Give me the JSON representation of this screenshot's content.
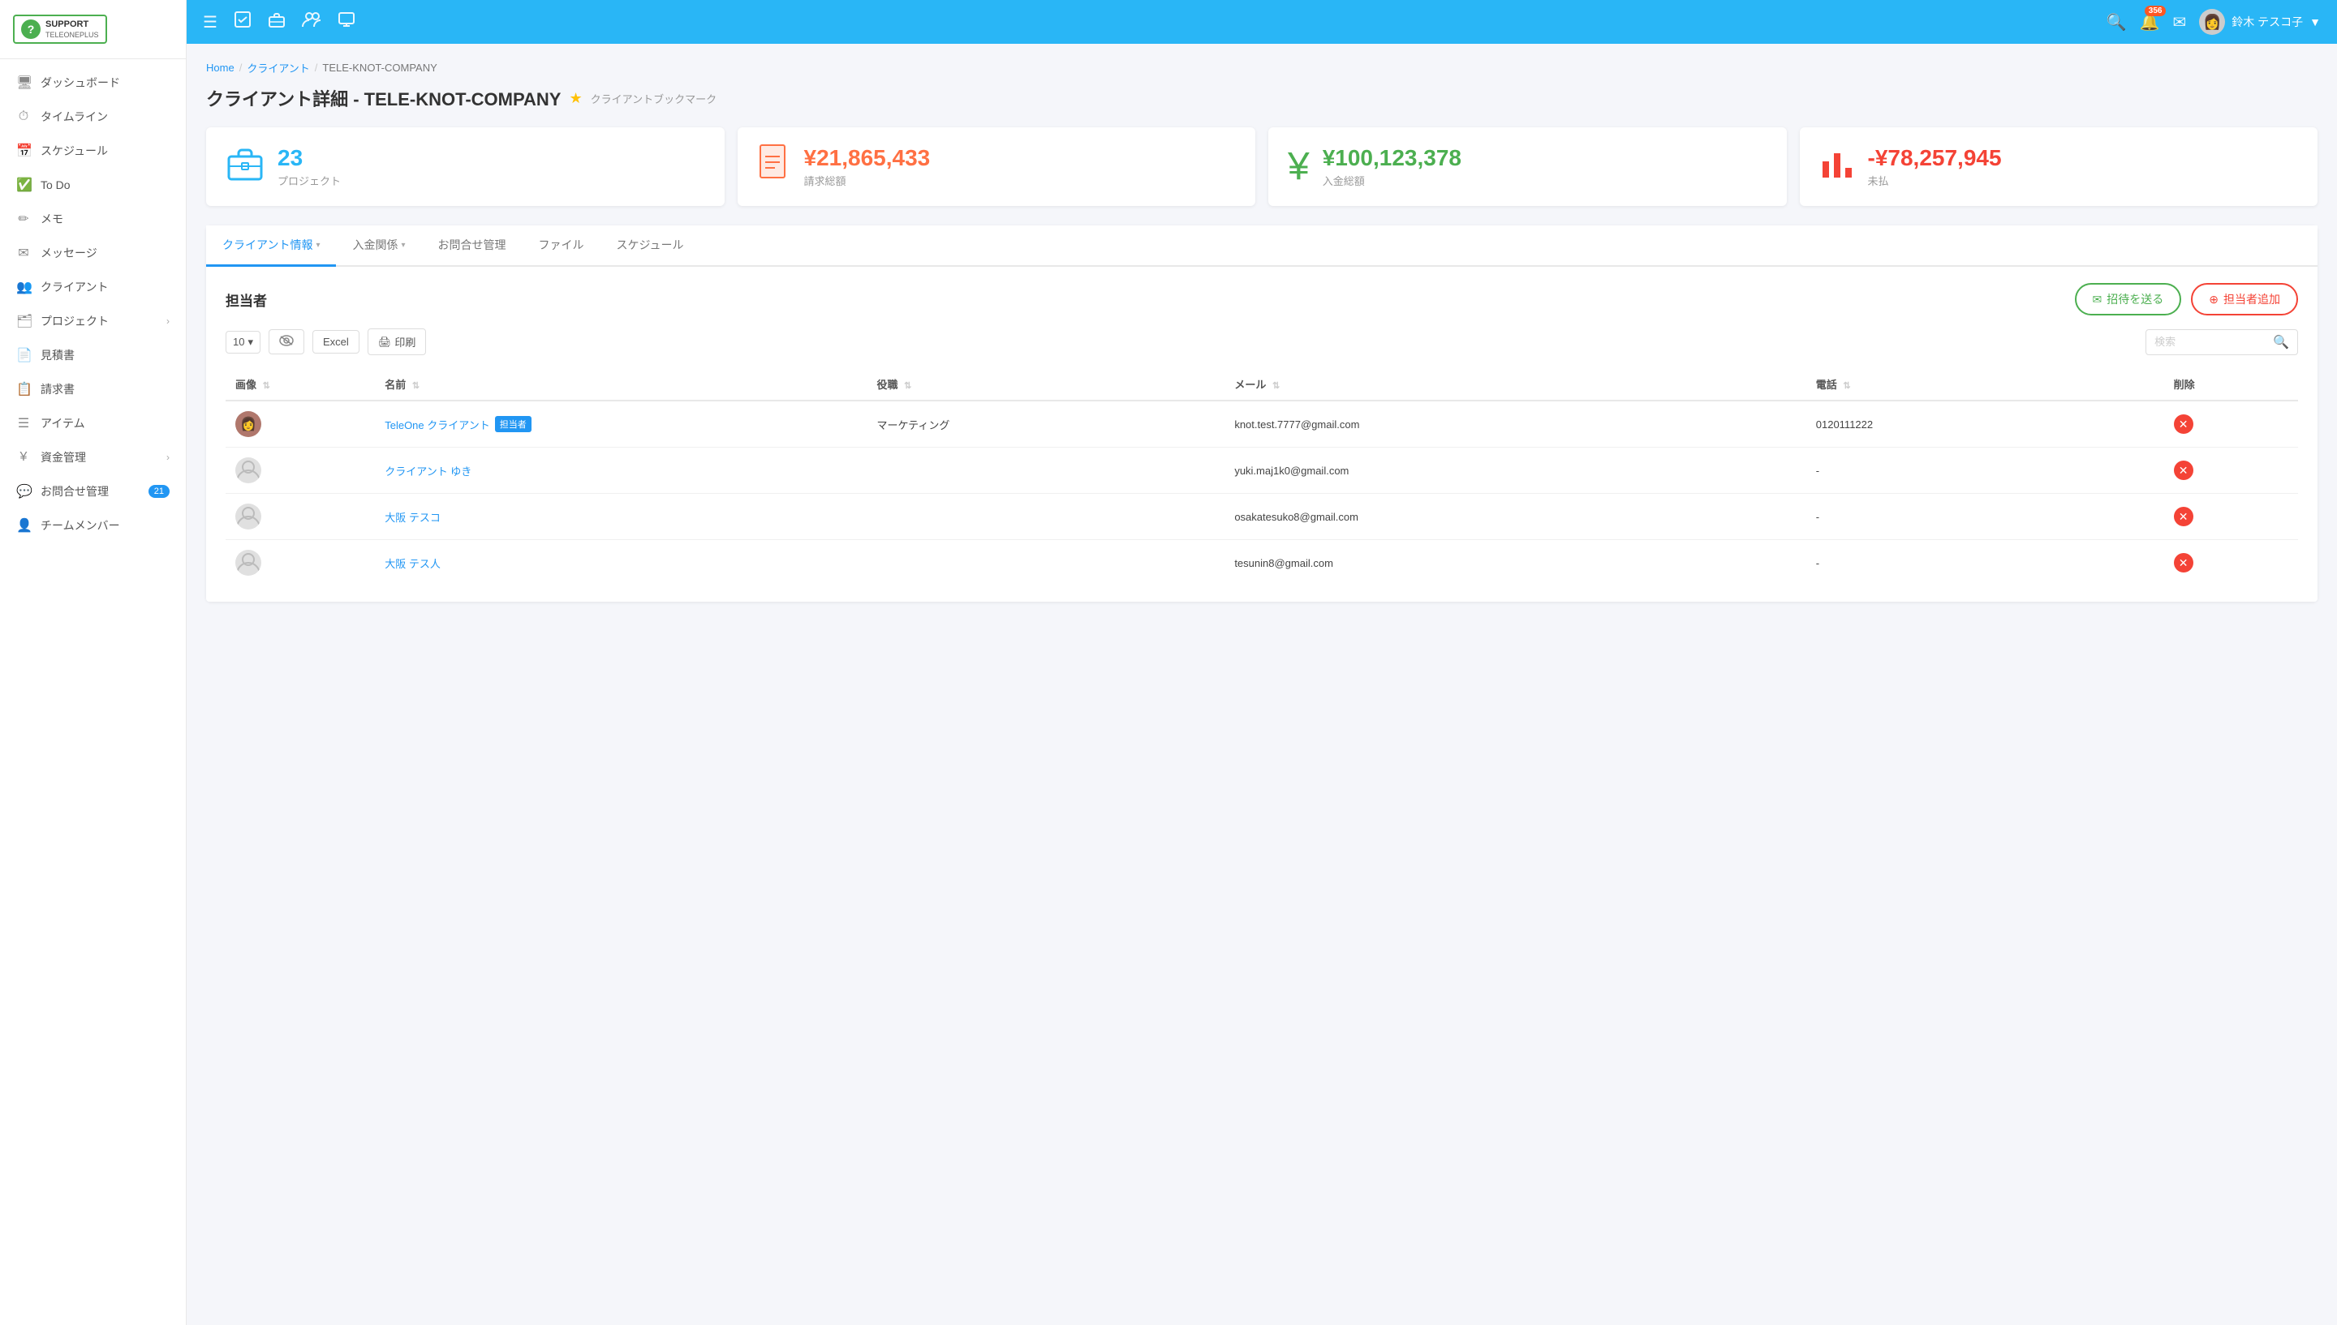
{
  "sidebar": {
    "logo": {
      "icon": "?",
      "text": "SUPPORT",
      "sub": "TELEONEPLUS"
    },
    "items": [
      {
        "id": "dashboard",
        "label": "ダッシュボード",
        "icon": "🖥",
        "badge": null,
        "arrow": false
      },
      {
        "id": "timeline",
        "label": "タイムライン",
        "icon": "⏱",
        "badge": null,
        "arrow": false
      },
      {
        "id": "schedule",
        "label": "スケジュール",
        "icon": "📅",
        "badge": null,
        "arrow": false
      },
      {
        "id": "todo",
        "label": "To Do",
        "icon": "✅",
        "badge": null,
        "arrow": false
      },
      {
        "id": "memo",
        "label": "メモ",
        "icon": "✏",
        "badge": null,
        "arrow": false
      },
      {
        "id": "message",
        "label": "メッセージ",
        "icon": "✉",
        "badge": null,
        "arrow": false
      },
      {
        "id": "client",
        "label": "クライアント",
        "icon": "👥",
        "badge": null,
        "arrow": false
      },
      {
        "id": "project",
        "label": "プロジェクト",
        "icon": "🗂",
        "badge": null,
        "arrow": true
      },
      {
        "id": "estimate",
        "label": "見積書",
        "icon": "📄",
        "badge": null,
        "arrow": false
      },
      {
        "id": "invoice",
        "label": "請求書",
        "icon": "📋",
        "badge": null,
        "arrow": false
      },
      {
        "id": "item",
        "label": "アイテム",
        "icon": "☰",
        "badge": null,
        "arrow": false
      },
      {
        "id": "finance",
        "label": "資金管理",
        "icon": "¥",
        "badge": null,
        "arrow": true
      },
      {
        "id": "inquiry",
        "label": "お問合せ管理",
        "icon": "💬",
        "badge": "21",
        "arrow": false
      },
      {
        "id": "team",
        "label": "チームメンバー",
        "icon": "👤",
        "badge": null,
        "arrow": false
      }
    ]
  },
  "header": {
    "notif_count": "356",
    "user_name": "鈴木 テスコ子",
    "icons": {
      "menu": "☰",
      "task": "✔",
      "briefcase": "💼",
      "people": "👥",
      "monitor": "🖥",
      "search": "🔍",
      "bell": "🔔",
      "mail": "✉"
    }
  },
  "breadcrumb": {
    "home": "Home",
    "client": "クライアント",
    "company": "TELE-KNOT-COMPANY"
  },
  "page": {
    "title": "クライアント詳細 - TELE-KNOT-COMPANY",
    "bookmark_label": "クライアントブックマーク"
  },
  "stats": {
    "projects": {
      "count": "23",
      "label": "プロジェクト"
    },
    "invoice_total": {
      "value": "¥21,865,433",
      "label": "請求総額"
    },
    "payment": {
      "main_value": "¥100,123,378",
      "main_label": "入金総額"
    },
    "unpaid": {
      "value": "-¥78,257,945",
      "label": "未払"
    }
  },
  "tabs": [
    {
      "id": "client-info",
      "label": "クライアント情報",
      "active": true,
      "dropdown": true
    },
    {
      "id": "payment",
      "label": "入金関係",
      "active": false,
      "dropdown": true
    },
    {
      "id": "inquiry",
      "label": "お問合せ管理",
      "active": false,
      "dropdown": false
    },
    {
      "id": "file",
      "label": "ファイル",
      "active": false,
      "dropdown": false
    },
    {
      "id": "schedule",
      "label": "スケジュール",
      "active": false,
      "dropdown": false
    }
  ],
  "section": {
    "title": "担当者",
    "invite_btn": "招待を送る",
    "add_btn": "担当者追加"
  },
  "toolbar": {
    "per_page": "10",
    "excel_btn": "Excel",
    "print_btn": "印刷",
    "search_placeholder": "検索"
  },
  "table": {
    "headers": [
      {
        "id": "image",
        "label": "画像"
      },
      {
        "id": "name",
        "label": "名前"
      },
      {
        "id": "role",
        "label": "役職"
      },
      {
        "id": "email",
        "label": "メール"
      },
      {
        "id": "phone",
        "label": "電話"
      },
      {
        "id": "delete",
        "label": "削除"
      }
    ],
    "rows": [
      {
        "id": 1,
        "avatar": "photo",
        "name": "TeleOne クライアント",
        "badge": "担当者",
        "role": "マーケティング",
        "email": "knot.test.7777@gmail.com",
        "phone": "0120111222"
      },
      {
        "id": 2,
        "avatar": "default",
        "name": "クライアント ゆき",
        "badge": null,
        "role": "",
        "email": "yuki.maj1k0@gmail.com",
        "phone": "-"
      },
      {
        "id": 3,
        "avatar": "default",
        "name": "大阪 テスコ",
        "badge": null,
        "role": "",
        "email": "osakatesuko8@gmail.com",
        "phone": "-"
      },
      {
        "id": 4,
        "avatar": "default",
        "name": "大阪 テス人",
        "badge": null,
        "role": "",
        "email": "tesunin8@gmail.com",
        "phone": "-"
      }
    ]
  }
}
